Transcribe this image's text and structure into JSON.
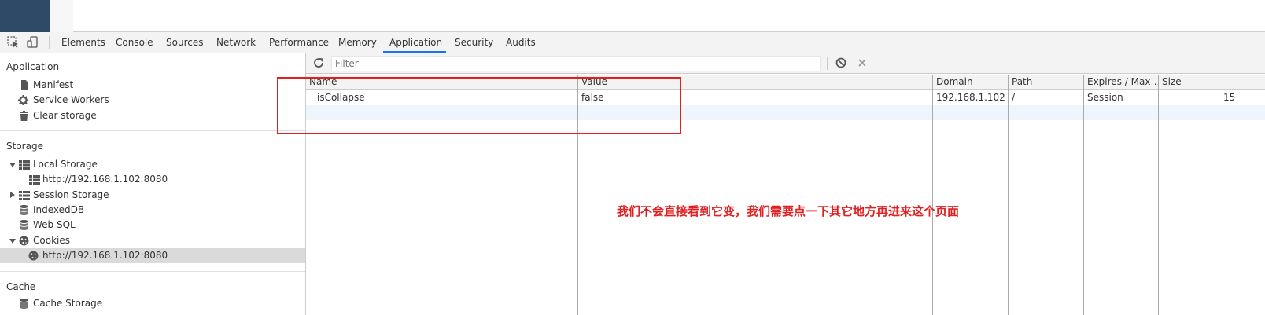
{
  "tabbar": {
    "tabs": [
      "Elements",
      "Console",
      "Sources",
      "Network",
      "Performance",
      "Memory",
      "Application",
      "Security",
      "Audits"
    ],
    "active_tab": "Application",
    "accent_color": "#1a73e8"
  },
  "sidebar": {
    "application": {
      "title": "Application",
      "items": [
        "Manifest",
        "Service Workers",
        "Clear storage"
      ]
    },
    "storage": {
      "title": "Storage",
      "local_storage": "Local Storage",
      "local_storage_origin": "http://192.168.1.102:8080",
      "session_storage": "Session Storage",
      "indexeddb": "IndexedDB",
      "web_sql": "Web SQL",
      "cookies": "Cookies",
      "cookies_origin": "http://192.168.1.102:8080"
    },
    "cache": {
      "title": "Cache",
      "cache_storage": "Cache Storage"
    }
  },
  "filter": {
    "placeholder": "Filter",
    "value": ""
  },
  "cookies_table": {
    "columns": [
      "Name",
      "Value",
      "Domain",
      "Path",
      "Expires / Max-...",
      "Size"
    ],
    "rows": [
      {
        "name": "isCollapse",
        "value": "false",
        "domain": "192.168.1.102",
        "path": "/",
        "expires": "Session",
        "size": "15"
      }
    ]
  },
  "annotation": {
    "text": "我们不会直接看到它变，我们需要点一下其它地方再进来这个页面",
    "color": "#e02020"
  }
}
